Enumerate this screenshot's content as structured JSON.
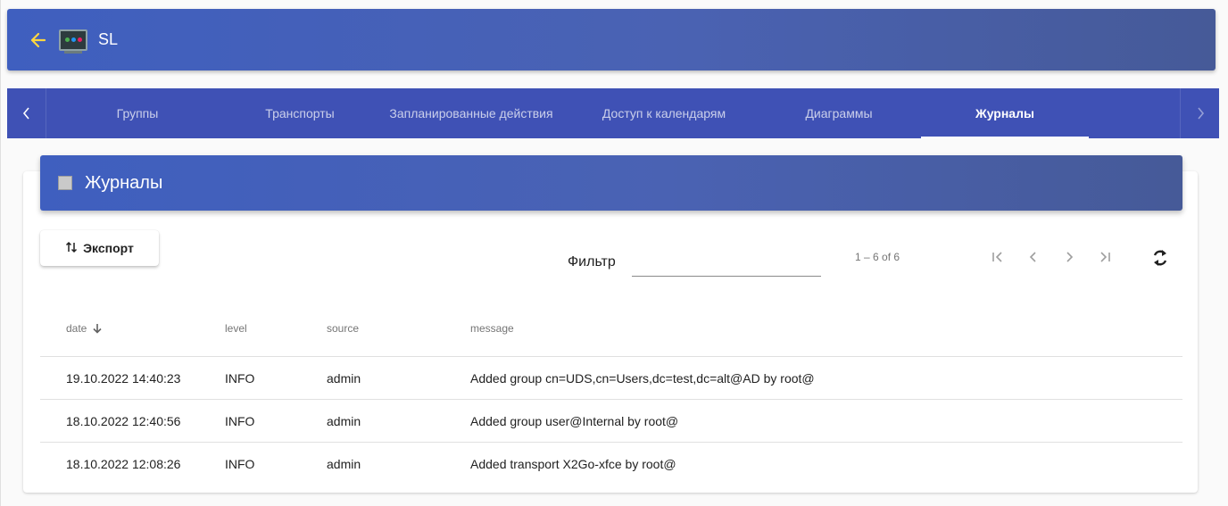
{
  "appbar": {
    "title": "SL",
    "back_icon": "arrow-left-icon",
    "logo_icon": "app-monitor-icon"
  },
  "tabs": {
    "items": [
      {
        "label": "Группы",
        "active": false
      },
      {
        "label": "Транспорты",
        "active": false
      },
      {
        "label": "Запланированные действия",
        "active": false
      },
      {
        "label": "Доступ к календарям",
        "active": false
      },
      {
        "label": "Диаграммы",
        "active": false
      },
      {
        "label": "Журналы",
        "active": true
      }
    ],
    "prev_icon": "chevron-left-icon",
    "next_icon": "chevron-right-icon"
  },
  "card": {
    "title": "Журналы"
  },
  "toolbar": {
    "export_label": "Экспорт",
    "filter_label": "Фильтр",
    "filter_value": ""
  },
  "paginator": {
    "range_label": "1 – 6 of 6"
  },
  "table": {
    "headers": {
      "date": "date",
      "level": "level",
      "source": "source",
      "message": "message"
    },
    "sort": {
      "column": "date",
      "direction": "desc"
    },
    "rows": [
      {
        "date": "19.10.2022 14:40:23",
        "level": "INFO",
        "source": "admin",
        "message": "Added group cn=UDS,cn=Users,dc=test,dc=alt@AD by root@"
      },
      {
        "date": "18.10.2022 12:40:56",
        "level": "INFO",
        "source": "admin",
        "message": "Added group user@Internal by root@"
      },
      {
        "date": "18.10.2022 12:08:26",
        "level": "INFO",
        "source": "admin",
        "message": "Added transport X2Go-xfce by root@"
      }
    ]
  },
  "colors": {
    "primary": "#3f51b5",
    "accent_arrow": "#ffd740"
  }
}
